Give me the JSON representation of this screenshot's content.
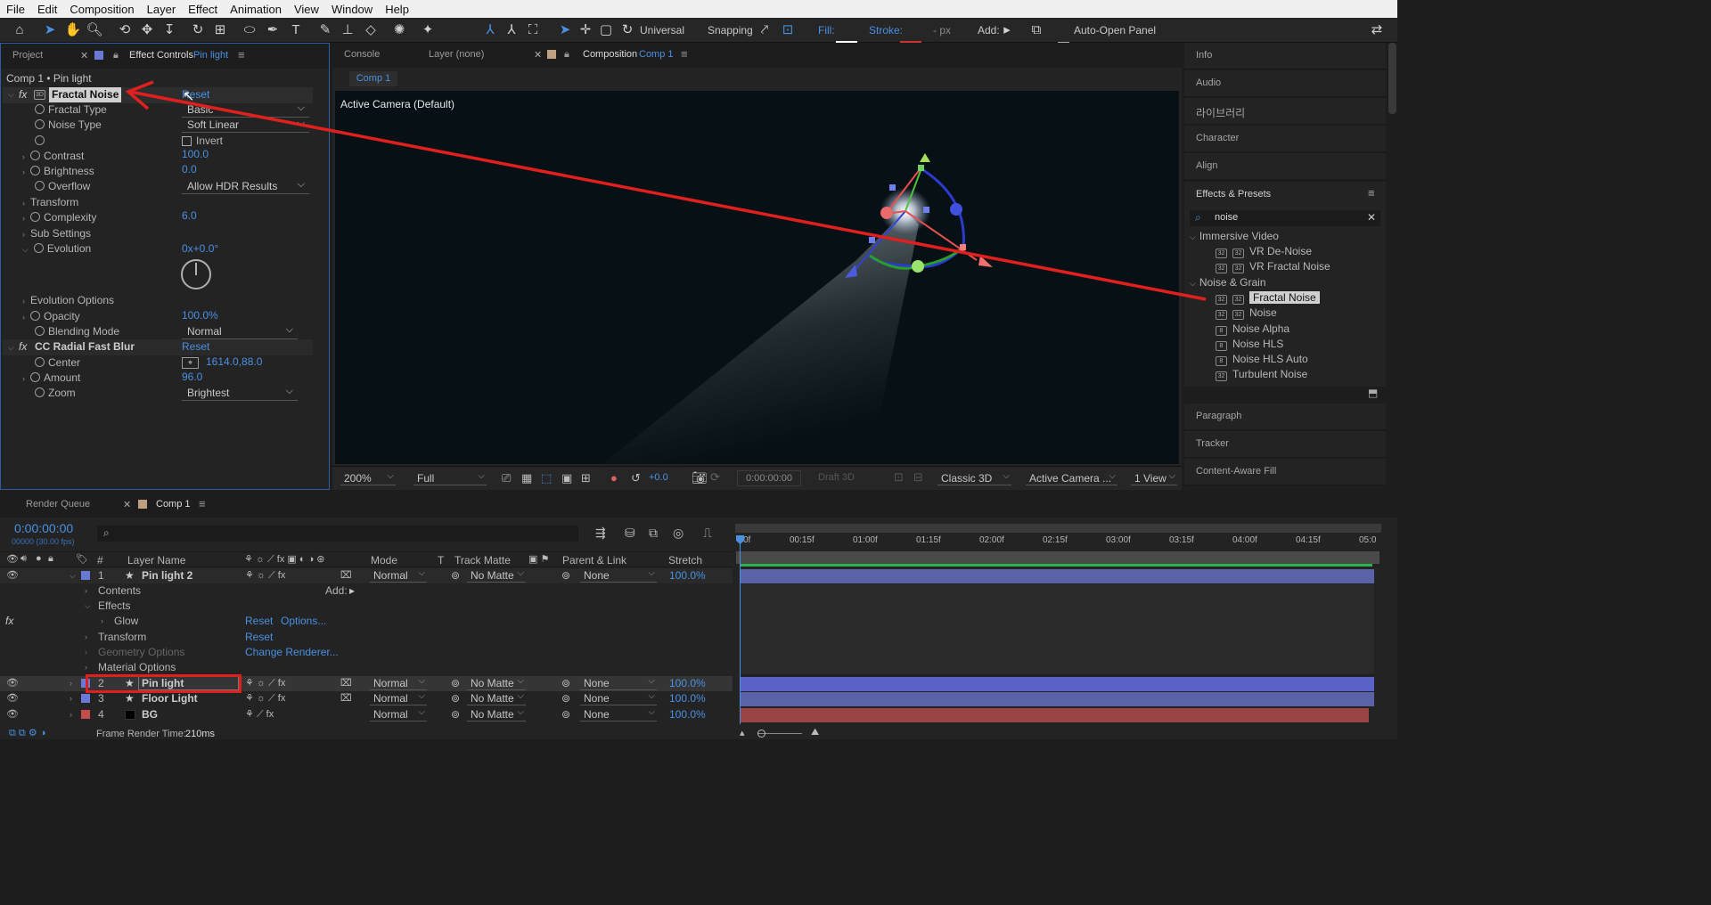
{
  "menu": [
    "File",
    "Edit",
    "Composition",
    "Layer",
    "Effect",
    "Animation",
    "View",
    "Window",
    "Help"
  ],
  "toolbar": {
    "universal": "Universal",
    "snapping": "Snapping",
    "fill": "Fill:",
    "stroke": "Stroke:",
    "px": "- px",
    "add": "Add:",
    "auto_open": "Auto-Open Panel"
  },
  "left_tabs": {
    "project": "Project",
    "effect_controls": "Effect Controls",
    "layer_name": "Pin light"
  },
  "effect_controls": {
    "breadcrumb": "Comp 1 • Pin light",
    "fx1_name": "Fractal Noise",
    "fx1_reset": "Reset",
    "rows": [
      {
        "label": "Fractal Type",
        "value": "Basic"
      },
      {
        "label": "Noise Type",
        "value": "Soft Linear"
      },
      {
        "label": "",
        "value": "Invert"
      },
      {
        "label": "Contrast",
        "value": "100.0"
      },
      {
        "label": "Brightness",
        "value": "0.0"
      },
      {
        "label": "Overflow",
        "value": "Allow HDR Results"
      },
      {
        "label": "Transform",
        "value": ""
      },
      {
        "label": "Complexity",
        "value": "6.0"
      },
      {
        "label": "Sub Settings",
        "value": ""
      },
      {
        "label": "Evolution",
        "value": "0x+0.0°"
      },
      {
        "label": "Evolution Options",
        "value": ""
      },
      {
        "label": "Opacity",
        "value": "100.0%"
      },
      {
        "label": "Blending Mode",
        "value": "Normal"
      }
    ],
    "fx2_name": "CC Radial Fast Blur",
    "fx2_reset": "Reset",
    "rows2": [
      {
        "label": "Center",
        "value": "1614.0,88.0"
      },
      {
        "label": "Amount",
        "value": "96.0"
      },
      {
        "label": "Zoom",
        "value": "Brightest"
      }
    ]
  },
  "comp_tabs": {
    "console": "Console",
    "layer": "Layer (none)",
    "composition": "Composition",
    "comp_name": "Comp 1",
    "subtab": "Comp 1"
  },
  "viewer": {
    "camera_label": "Active Camera (Default)",
    "zoom": "200%",
    "resolution": "Full",
    "exposure": "+0.0",
    "timecode": "0:00:00:00",
    "draft3d": "Draft 3D",
    "renderer": "Classic 3D",
    "camera": "Active Camera ...",
    "views": "1 View"
  },
  "right_panel": {
    "top_items": [
      "Info",
      "Audio",
      "라이브러리",
      "Character",
      "Align"
    ],
    "effects_title": "Effects & Presets",
    "search_value": "noise",
    "groups": [
      {
        "name": "Immersive Video",
        "items": [
          "VR De-Noise",
          "VR Fractal Noise"
        ]
      },
      {
        "name": "Noise & Grain",
        "items": [
          "Fractal Noise",
          "Noise",
          "Noise Alpha",
          "Noise HLS",
          "Noise HLS Auto",
          "Turbulent Noise"
        ]
      }
    ],
    "bottom_items": [
      "Paragraph",
      "Tracker",
      "Content-Aware Fill"
    ]
  },
  "timeline": {
    "render_queue": "Render Queue",
    "comp_tab": "Comp 1",
    "timecode": "0:00:00:00",
    "frame_info": "00000 (30.00 fps)",
    "col_headers": {
      "num": "#",
      "layer_name": "Layer Name",
      "mode": "Mode",
      "t": "T",
      "track_matte": "Track Matte",
      "parent": "Parent & Link",
      "stretch": "Stretch"
    },
    "ruler": [
      "0f",
      "00:15f",
      "01:00f",
      "01:15f",
      "02:00f",
      "02:15f",
      "03:00f",
      "03:15f",
      "04:00f",
      "04:15f",
      "05:0"
    ],
    "layers": [
      {
        "num": "1",
        "name": "Pin light 2",
        "mode": "Normal",
        "matte": "No Matte",
        "parent": "None",
        "stretch": "100.0%",
        "color": "#6a79d6"
      },
      {
        "num": "2",
        "name": "Pin light",
        "mode": "Normal",
        "matte": "No Matte",
        "parent": "None",
        "stretch": "100.0%",
        "color": "#6a79d6"
      },
      {
        "num": "3",
        "name": "Floor Light",
        "mode": "Normal",
        "matte": "No Matte",
        "parent": "None",
        "stretch": "100.0%",
        "color": "#6a79d6"
      },
      {
        "num": "4",
        "name": "BG",
        "mode": "Normal",
        "matte": "No Matte",
        "parent": "None",
        "stretch": "100.0%",
        "color": "#c84b4b"
      }
    ],
    "sub": {
      "contents": "Contents",
      "add": "Add:",
      "effects": "Effects",
      "glow": "Glow",
      "glow_reset": "Reset",
      "glow_options": "Options...",
      "transform": "Transform",
      "transform_reset": "Reset",
      "geometry": "Geometry Options",
      "change_renderer": "Change Renderer...",
      "material": "Material Options"
    },
    "status_label": "Frame Render Time:",
    "status_value": "210ms"
  }
}
